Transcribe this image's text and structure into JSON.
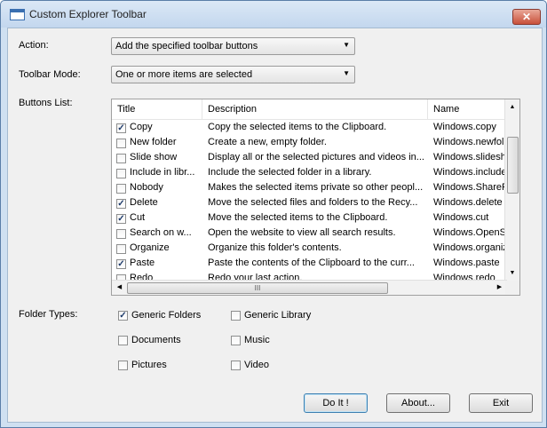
{
  "window": {
    "title": "Custom Explorer Toolbar",
    "close_label": "✕"
  },
  "action": {
    "label": "Action:",
    "value": "Add the specified toolbar buttons"
  },
  "toolbar_mode": {
    "label": "Toolbar Mode:",
    "value": "One or more items are selected"
  },
  "buttons_list": {
    "label": "Buttons List:",
    "columns": [
      "Title",
      "Description",
      "Name"
    ],
    "rows": [
      {
        "title": "Copy",
        "description": "Copy the selected items to the Clipboard.",
        "name": "Windows.copy",
        "checked": true
      },
      {
        "title": "New folder",
        "description": "Create a new, empty folder.",
        "name": "Windows.newfol",
        "checked": false
      },
      {
        "title": "Slide show",
        "description": "Display all or the selected pictures and videos in...",
        "name": "Windows.slidesh",
        "checked": false
      },
      {
        "title": "Include in libr...",
        "description": "Include the selected folder in a library.",
        "name": "Windows.include",
        "checked": false
      },
      {
        "title": "Nobody",
        "description": "Makes the selected items private so other peopl...",
        "name": "Windows.ShareP",
        "checked": false
      },
      {
        "title": "Delete",
        "description": "Move the selected files and folders to the Recy...",
        "name": "Windows.delete",
        "checked": true
      },
      {
        "title": "Cut",
        "description": "Move the selected items to the Clipboard.",
        "name": "Windows.cut",
        "checked": true
      },
      {
        "title": "Search on w...",
        "description": "Open the website to view all search results.",
        "name": "Windows.OpenS",
        "checked": false
      },
      {
        "title": "Organize",
        "description": "Organize this folder's contents.",
        "name": "Windows.organiz",
        "checked": false
      },
      {
        "title": "Paste",
        "description": "Paste the contents of the Clipboard to the curr...",
        "name": "Windows.paste",
        "checked": true
      },
      {
        "title": "Redo",
        "description": "Redo your last action.",
        "name": "Windows.redo",
        "checked": false
      }
    ]
  },
  "folder_types": {
    "label": "Folder Types:",
    "items": [
      {
        "label": "Generic Folders",
        "checked": true
      },
      {
        "label": "Generic Library",
        "checked": false
      },
      {
        "label": "Documents",
        "checked": false
      },
      {
        "label": "Music",
        "checked": false
      },
      {
        "label": "Pictures",
        "checked": false
      },
      {
        "label": "Video",
        "checked": false
      }
    ]
  },
  "buttons": {
    "do_it": "Do It !",
    "about": "About...",
    "exit": "Exit"
  },
  "icons": {
    "check": "✓",
    "dropdown": "▼",
    "scroll_up": "▲",
    "scroll_down": "▼",
    "scroll_left": "◀",
    "scroll_right": "▶",
    "grip": "III"
  }
}
